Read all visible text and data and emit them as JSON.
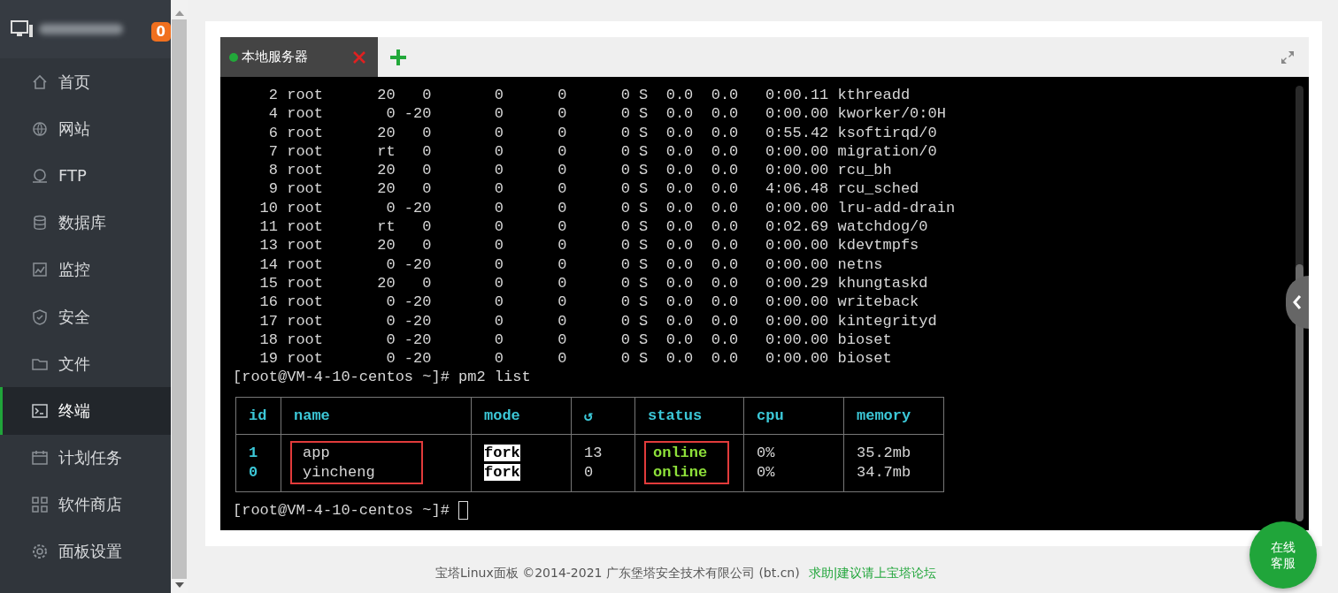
{
  "sidebar": {
    "badge": "0",
    "items": [
      {
        "label": "首页",
        "selected": false
      },
      {
        "label": "网站",
        "selected": false
      },
      {
        "label": "FTP",
        "selected": false
      },
      {
        "label": "数据库",
        "selected": false
      },
      {
        "label": "监控",
        "selected": false
      },
      {
        "label": "安全",
        "selected": false
      },
      {
        "label": "文件",
        "selected": false
      },
      {
        "label": "终端",
        "selected": true
      },
      {
        "label": "计划任务",
        "selected": false
      },
      {
        "label": "软件商店",
        "selected": false
      },
      {
        "label": "面板设置",
        "selected": false
      }
    ]
  },
  "terminal": {
    "tabs": [
      {
        "label": "本地服务器",
        "selected": true,
        "connected": true
      }
    ],
    "lines": [
      "    2 root      20   0       0      0      0 S  0.0  0.0   0:00.11 kthreadd",
      "    4 root       0 -20       0      0      0 S  0.0  0.0   0:00.00 kworker/0:0H",
      "    6 root      20   0       0      0      0 S  0.0  0.0   0:55.42 ksoftirqd/0",
      "    7 root      rt   0       0      0      0 S  0.0  0.0   0:00.00 migration/0",
      "    8 root      20   0       0      0      0 S  0.0  0.0   0:00.00 rcu_bh",
      "    9 root      20   0       0      0      0 S  0.0  0.0   4:06.48 rcu_sched",
      "   10 root       0 -20       0      0      0 S  0.0  0.0   0:00.00 lru-add-drain",
      "   11 root      rt   0       0      0      0 S  0.0  0.0   0:02.69 watchdog/0",
      "   13 root      20   0       0      0      0 S  0.0  0.0   0:00.00 kdevtmpfs",
      "   14 root       0 -20       0      0      0 S  0.0  0.0   0:00.00 netns",
      "   15 root      20   0       0      0      0 S  0.0  0.0   0:00.29 khungtaskd",
      "   16 root       0 -20       0      0      0 S  0.0  0.0   0:00.00 writeback",
      "   17 root       0 -20       0      0      0 S  0.0  0.0   0:00.00 kintegrityd",
      "   18 root       0 -20       0      0      0 S  0.0  0.0   0:00.00 bioset",
      "   19 root       0 -20       0      0      0 S  0.0  0.0   0:00.00 bioset",
      "[root@VM-4-10-centos ~]# pm2 list"
    ],
    "pm2_table": {
      "columns": [
        {
          "header": "id",
          "kind": "id",
          "highlighted": false
        },
        {
          "header": "name",
          "kind": "plain",
          "highlighted": true
        },
        {
          "header": "mode",
          "kind": "inverse",
          "highlighted": false
        },
        {
          "header": "↺",
          "kind": "plain",
          "highlighted": false
        },
        {
          "header": "status",
          "kind": "status",
          "highlighted": true
        },
        {
          "header": "cpu",
          "kind": "plain",
          "highlighted": false
        },
        {
          "header": "memory",
          "kind": "plain",
          "highlighted": false
        }
      ],
      "rows": [
        [
          "1",
          "app",
          "fork",
          "13",
          "online",
          "0%",
          "35.2mb"
        ],
        [
          "0",
          "yincheng",
          "fork",
          "0",
          "online",
          "0%",
          "34.7mb"
        ]
      ]
    },
    "prompt": "[root@VM-4-10-centos ~]#"
  },
  "footer": {
    "copyright": "宝塔Linux面板 ©2014-2021 广东堡塔安全技术有限公司 (bt.cn)",
    "link": "求助|建议请上宝塔论坛"
  },
  "chat_button": "在线客服"
}
